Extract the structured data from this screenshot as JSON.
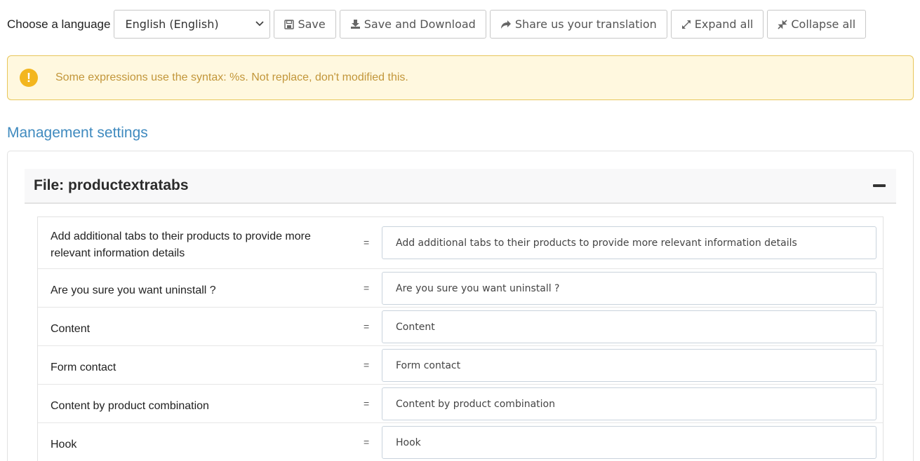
{
  "toolbar": {
    "language_label": "Choose a language",
    "language_selected": "English (English)",
    "buttons": [
      {
        "label": "Save",
        "icon": "floppy-icon"
      },
      {
        "label": "Save and Download",
        "icon": "download-icon"
      },
      {
        "label": "Share us your translation",
        "icon": "share-icon"
      },
      {
        "label": "Expand all",
        "icon": "expand-icon"
      },
      {
        "label": "Collapse all",
        "icon": "compress-icon"
      }
    ]
  },
  "alert": {
    "icon": "warning-icon",
    "message": "Some expressions use the syntax: %s. Not replace, don't modified this."
  },
  "section": {
    "title": "Management settings"
  },
  "file": {
    "title": "File: productextratabs",
    "rows": [
      {
        "source": "Add additional tabs to their products to provide more relevant information details",
        "separator": "=",
        "value": "Add additional tabs to their products to provide more relevant information details"
      },
      {
        "source": "Are you sure you want uninstall ?",
        "separator": "=",
        "value": "Are you sure you want uninstall ?"
      },
      {
        "source": "Content",
        "separator": "=",
        "value": "Content"
      },
      {
        "source": "Form contact",
        "separator": "=",
        "value": "Form contact"
      },
      {
        "source": "Content by product combination",
        "separator": "=",
        "value": "Content by product combination"
      },
      {
        "source": "Hook",
        "separator": "=",
        "value": "Hook"
      }
    ]
  }
}
